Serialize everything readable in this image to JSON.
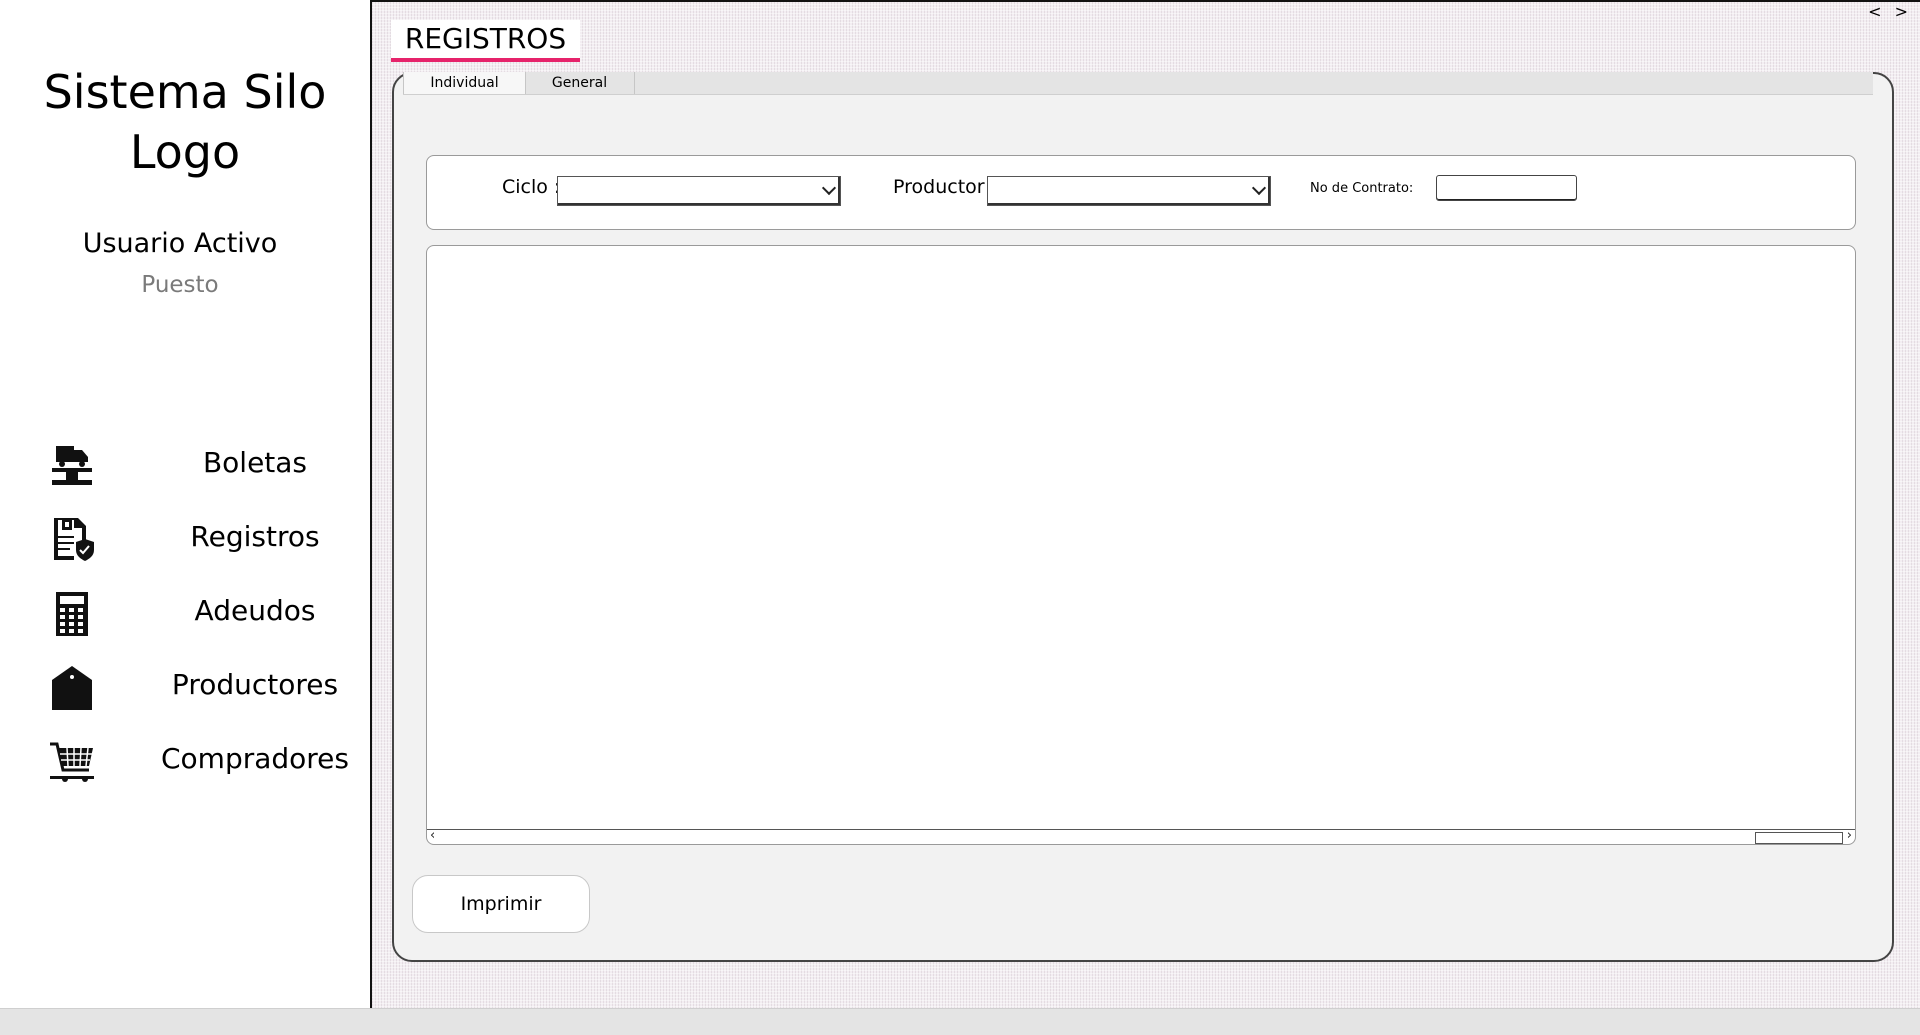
{
  "app": {
    "title_line1": "Sistema Silo",
    "title_line2": "Logo"
  },
  "user": {
    "name": "Usuario Activo",
    "role": "Puesto"
  },
  "nav": {
    "items": [
      {
        "label": "Boletas",
        "icon": "truck-scale-icon"
      },
      {
        "label": "Registros",
        "icon": "document-shield-icon"
      },
      {
        "label": "Adeudos",
        "icon": "calculator-icon"
      },
      {
        "label": "Productores",
        "icon": "house-icon"
      },
      {
        "label": "Compradores",
        "icon": "shopping-cart-icon"
      }
    ]
  },
  "page": {
    "title": "REGISTROS",
    "accent_color": "#e6236b"
  },
  "tabs": [
    {
      "label": "Individual",
      "active": true
    },
    {
      "label": "General",
      "active": false
    }
  ],
  "filters": {
    "ciclo_label": "Ciclo :",
    "ciclo_value": "",
    "productor_label": "Productor",
    "productor_value": "",
    "contrato_label": "No de Contrato:",
    "contrato_value": ""
  },
  "actions": {
    "print_label": "Imprimir"
  },
  "window_controls": {
    "arrows": "< >"
  }
}
